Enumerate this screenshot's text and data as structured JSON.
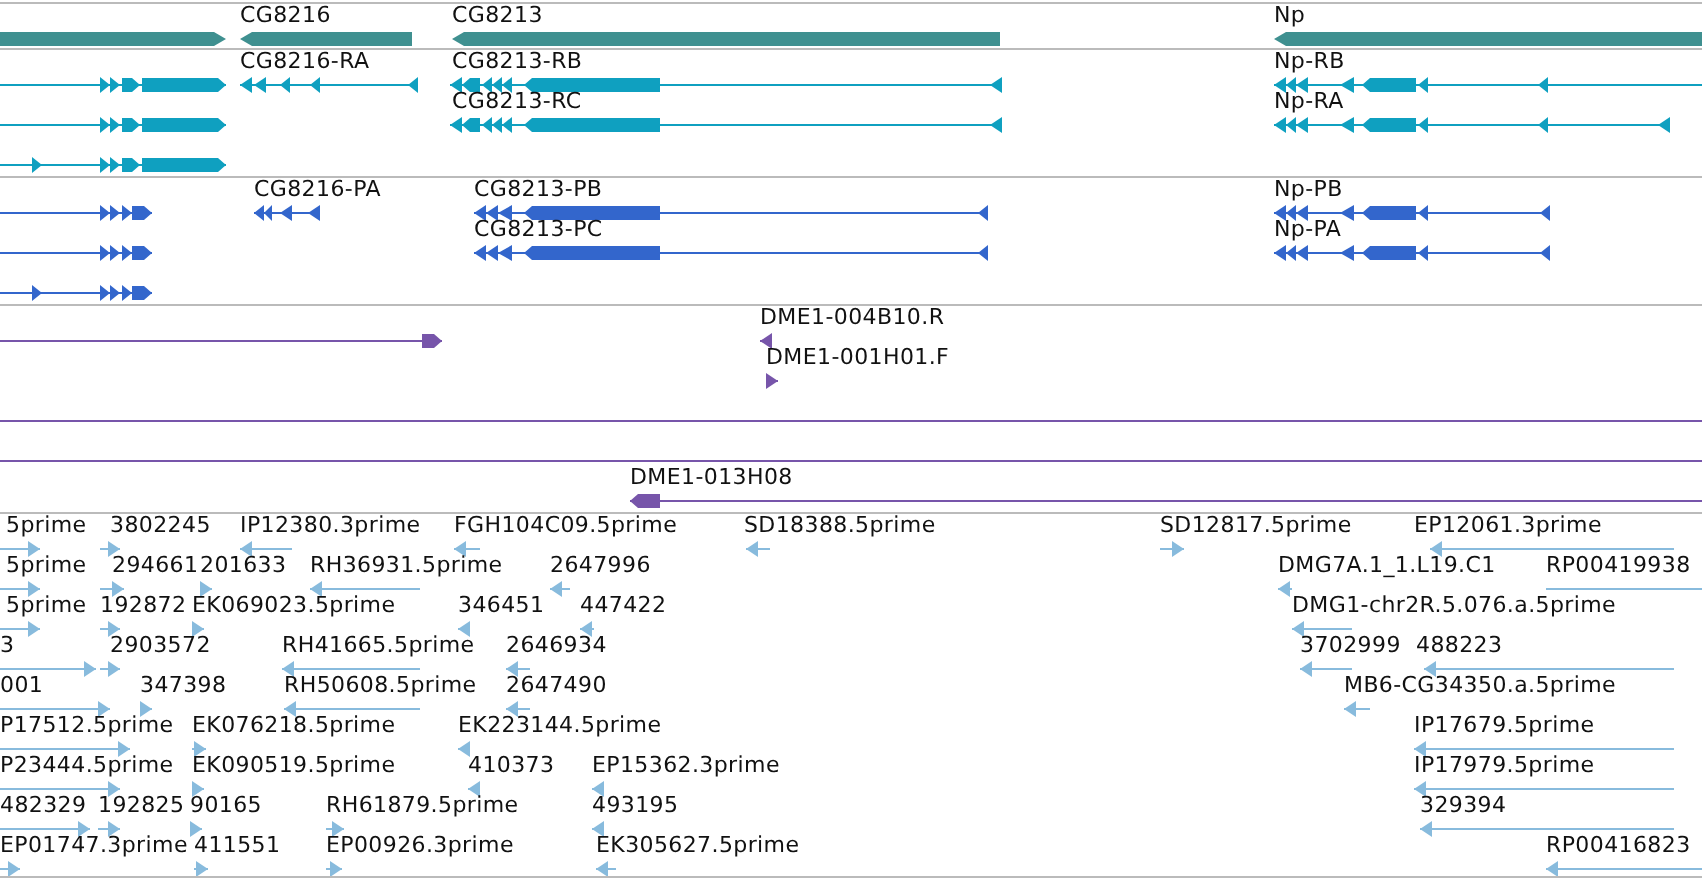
{
  "tracks": [
    {
      "kind": "gene",
      "features": [
        {
          "reverse": false
        },
        {
          "label": "CG8216",
          "reverse": true
        },
        {
          "label": "CG8213",
          "reverse": true
        },
        {
          "label": "Np",
          "reverse": true
        }
      ]
    },
    {
      "kind": "transcript",
      "features": [
        {
          "reverse": false
        },
        {
          "label": "CG8216-RA",
          "reverse": true
        },
        {
          "label": "CG8213-RB",
          "reverse": true
        },
        {
          "label": "Np-RB",
          "reverse": true
        },
        {
          "reverse": false
        },
        {
          "label": "CG8213-RC",
          "reverse": true
        },
        {
          "label": "Np-RA",
          "reverse": true
        },
        {
          "reverse": false
        }
      ]
    },
    {
      "kind": "protein",
      "features": [
        {
          "reverse": false
        },
        {
          "label": "CG8216-PA",
          "reverse": true
        },
        {
          "label": "CG8213-PB",
          "reverse": true
        },
        {
          "label": "Np-PB",
          "reverse": true
        },
        {
          "reverse": false
        },
        {
          "label": "CG8213-PC",
          "reverse": true
        },
        {
          "label": "Np-PA",
          "reverse": true
        },
        {
          "reverse": false
        }
      ]
    },
    {
      "kind": "clone",
      "features": [
        {
          "reverse": false
        },
        {
          "label": "DME1-004B10.R",
          "reverse": true
        },
        {
          "label": "DME1-001H01.F",
          "reverse": false
        },
        {
          "kind": "continuous"
        },
        {
          "kind": "continuous"
        },
        {
          "label": "DME1-013H08",
          "reverse": true
        }
      ]
    },
    {
      "kind": "est",
      "features": [
        {
          "label": "5prime",
          "reverse": false
        },
        {
          "label": "3802245",
          "reverse": false
        },
        {
          "label": "IP12380.3prime",
          "reverse": true
        },
        {
          "label": "FGH104C09.5prime",
          "reverse": true
        },
        {
          "label": "SD18388.5prime",
          "reverse": true
        },
        {
          "label": "SD12817.5prime",
          "reverse": false
        },
        {
          "label": "EP12061.3prime",
          "reverse": true
        },
        {
          "label": "5prime",
          "reverse": false
        },
        {
          "label": "294661",
          "reverse": false
        },
        {
          "label": "201633",
          "reverse": false
        },
        {
          "label": "RH36931.5prime",
          "reverse": true
        },
        {
          "label": "2647996",
          "reverse": true
        },
        {
          "label": "DMG7A.1_1.L19.C1",
          "reverse": true
        },
        {
          "label": "RP00419938",
          "kind": "continuous"
        },
        {
          "label": "5prime",
          "reverse": false
        },
        {
          "label": "192872",
          "reverse": false
        },
        {
          "label": "EK069023.5prime",
          "reverse": false
        },
        {
          "label": "346451",
          "reverse": true
        },
        {
          "label": "447422",
          "reverse": true
        },
        {
          "label": "DMG1-chr2R.5.076.a.5prime",
          "reverse": true
        },
        {
          "label": "3",
          "reverse": false
        },
        {
          "label": "2903572",
          "reverse": false
        },
        {
          "label": "RH41665.5prime",
          "reverse": true
        },
        {
          "label": "2646934",
          "reverse": true
        },
        {
          "label": "3702999",
          "reverse": true
        },
        {
          "label": "488223",
          "reverse": true
        },
        {
          "label": "001",
          "reverse": false
        },
        {
          "label": "347398",
          "reverse": false
        },
        {
          "label": "RH50608.5prime",
          "reverse": true
        },
        {
          "label": "2647490",
          "reverse": true
        },
        {
          "label": "MB6-CG34350.a.5prime",
          "reverse": true
        },
        {
          "label": "P17512.5prime",
          "reverse": false
        },
        {
          "label": "EK076218.5prime",
          "reverse": false
        },
        {
          "label": "EK223144.5prime",
          "reverse": true
        },
        {
          "label": "IP17679.5prime",
          "reverse": true
        },
        {
          "label": "P23444.5prime",
          "reverse": false
        },
        {
          "label": "EK090519.5prime",
          "reverse": false
        },
        {
          "label": "410373",
          "reverse": true
        },
        {
          "label": "EP15362.3prime",
          "reverse": true
        },
        {
          "label": "IP17979.5prime",
          "reverse": true
        },
        {
          "label": "482329",
          "reverse": false
        },
        {
          "label": "192825",
          "reverse": false
        },
        {
          "label": "90165",
          "reverse": false
        },
        {
          "label": "RH61879.5prime",
          "reverse": false
        },
        {
          "label": "493195",
          "reverse": true
        },
        {
          "label": "329394",
          "reverse": true
        },
        {
          "label": "EP01747.3prime",
          "reverse": false
        },
        {
          "label": "411551",
          "reverse": false
        },
        {
          "label": "EP00926.3prime",
          "reverse": false
        },
        {
          "label": "EK305627.5prime",
          "reverse": true
        },
        {
          "label": "RP00416823",
          "reverse": true
        }
      ]
    }
  ]
}
